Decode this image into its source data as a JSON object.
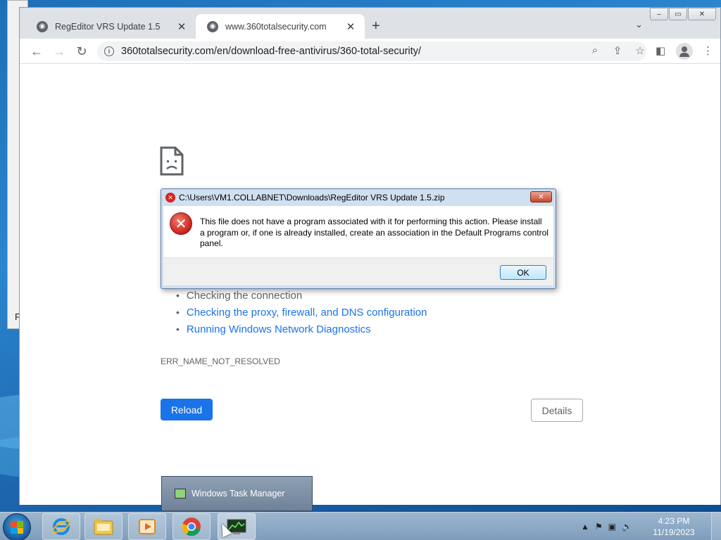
{
  "browser": {
    "tabs": [
      {
        "title": "RegEditor VRS Update 1.5",
        "active": false
      },
      {
        "title": "www.360totalsecurity.com",
        "active": true
      }
    ],
    "url": "360totalsecurity.com/en/download-free-antivirus/360-total-security/",
    "new_tab_symbol": "+",
    "window_controls": {
      "minimize": "–",
      "maximize": "▭",
      "close": "✕"
    }
  },
  "error_page": {
    "suggestions": [
      {
        "text": "Checking the connection",
        "link": false
      },
      {
        "text": "Checking the proxy, firewall, and DNS configuration",
        "link": true
      },
      {
        "text": "Running Windows Network Diagnostics",
        "link": true
      }
    ],
    "error_code": "ERR_NAME_NOT_RESOLVED",
    "reload_label": "Reload",
    "details_label": "Details"
  },
  "dialog": {
    "title": "C:\\Users\\VM1.COLLABNET\\Downloads\\RegEditor VRS Update 1.5.zip",
    "message": "This file does not have a program associated with it for performing this action. Please install a program or, if one is already installed, create an association in the Default Programs control panel.",
    "ok_label": "OK"
  },
  "taskbar": {
    "thumbnail_title": "Windows Task Manager",
    "time": "4:23 PM",
    "date": "11/19/2023",
    "pinned": [
      "internet-explorer",
      "windows-explorer",
      "media-player",
      "chrome",
      "task-manager"
    ]
  },
  "desktop": {
    "partial_window_letter": "P"
  },
  "colors": {
    "chrome_blue": "#1a73e8",
    "error_red": "#d6251f",
    "taskbar": "#8aa6c2"
  }
}
